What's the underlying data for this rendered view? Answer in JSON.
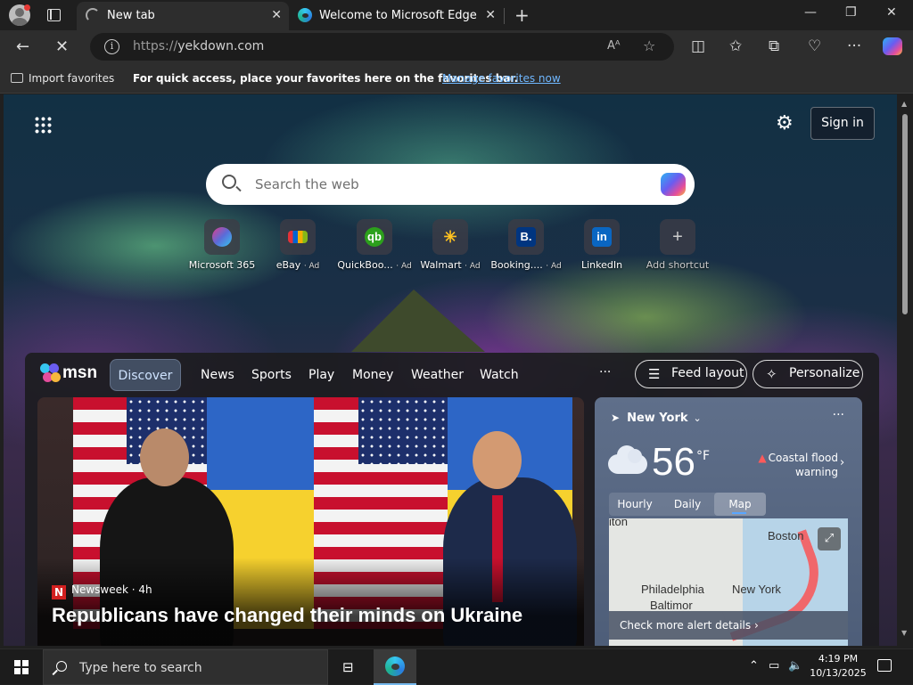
{
  "browser": {
    "tabs": [
      {
        "title": "New tab",
        "state": "loading"
      },
      {
        "title": "Welcome to Microsoft Edge",
        "state": "idle"
      }
    ],
    "address": {
      "protocol": "https://",
      "host": "yekdown.com"
    },
    "favorites_bar": {
      "import_label": "Import favorites",
      "message": "For quick access, place your favorites here on the favorites bar.",
      "manage_link": "Manage favorites now"
    },
    "toolbar_icons": [
      "read-aloud-icon",
      "favorite-star-icon",
      "split-screen-icon",
      "favorites-icon",
      "collections-icon",
      "browser-essentials-icon",
      "more-icon",
      "copilot-icon"
    ]
  },
  "newtab": {
    "signin_label": "Sign in",
    "search_placeholder": "Search the web",
    "shortcuts": [
      {
        "label": "Microsoft 365",
        "ad": "",
        "color": "#5b6bd8"
      },
      {
        "label": "eBay",
        "ad": "· Ad",
        "color": "#e53238"
      },
      {
        "label": "QuickBoo...",
        "ad": "· Ad",
        "color": "#2ca01c"
      },
      {
        "label": "Walmart",
        "ad": "· Ad",
        "color": "#0071ce"
      },
      {
        "label": "Booking....",
        "ad": "· Ad",
        "color": "#003580"
      },
      {
        "label": "LinkedIn",
        "ad": "",
        "color": "#0a66c2"
      },
      {
        "label": "Add shortcut",
        "ad": "",
        "color": "#6b6b6b"
      }
    ]
  },
  "msn": {
    "brand": "msn",
    "tabs": [
      "Discover",
      "News",
      "Sports",
      "Play",
      "Money",
      "Weather",
      "Watch"
    ],
    "more": "···",
    "feed_layout": "Feed layout",
    "personalize": "Personalize",
    "hero": {
      "source_badge": "N",
      "source": "Newsweek · 4h",
      "headline": "Republicans have changed their minds on Ukraine"
    },
    "weather": {
      "location": "New York",
      "temp": "56",
      "unit": "°F",
      "alert_line1": "Coastal flood",
      "alert_line2": "warning",
      "tabs": [
        "Hourly",
        "Daily",
        "Map"
      ],
      "active_tab": "Map",
      "map_cities": [
        "Boston",
        "Philadelphia",
        "New York",
        "Baltimor",
        "iton"
      ],
      "footer": "Check more alert details"
    }
  },
  "taskbar": {
    "search_placeholder": "Type here to search",
    "time": "4:19 PM",
    "date": "10/13/2025"
  }
}
